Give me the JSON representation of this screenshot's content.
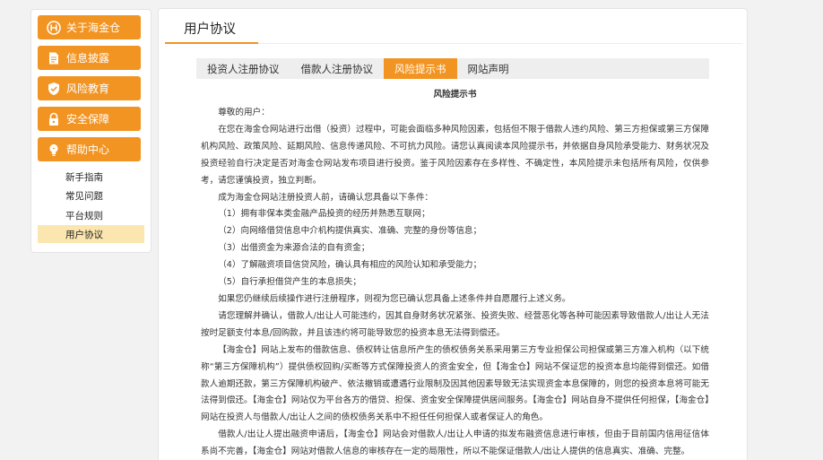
{
  "sidebar": {
    "menu": [
      {
        "label": "关于海金仓",
        "icon": "h-logo-icon"
      },
      {
        "label": "信息披露",
        "icon": "document-icon"
      },
      {
        "label": "风险教育",
        "icon": "shield-icon"
      },
      {
        "label": "安全保障",
        "icon": "lock-icon"
      },
      {
        "label": "帮助中心",
        "icon": "lightbulb-icon"
      }
    ],
    "help_items": [
      "新手指南",
      "常见问题",
      "平台规则",
      "用户协议"
    ],
    "active_item": "用户协议"
  },
  "main": {
    "title": "用户协议",
    "tabs": [
      "投资人注册协议",
      "借款人注册协议",
      "风险提示书",
      "网站声明"
    ],
    "active_tab": "风险提示书"
  },
  "document": {
    "title": "风险提示书",
    "greeting": "尊敬的用户：",
    "paragraphs": [
      "在您在海金仓网站进行出借（投资）过程中，可能会面临多种风险因素，包括但不限于借款人违约风险、第三方担保或第三方保障机构风险、政策风险、延期风险、信息传递风险、不可抗力风险。请您认真阅读本风险提示书，并依据自身风险承受能力、财务状况及投资经验自行决定是否对海金仓网站发布项目进行投资。鉴于风险因素存在多样性、不确定性，本风险提示未包括所有风险，仅供参考，请您谨慎投资，独立判断。",
      "成为海金仓网站注册投资人前，请确认您具备以下条件：",
      "（1）拥有非保本类金融产品投资的经历并熟悉互联网；",
      "（2）向网络借贷信息中介机构提供真实、准确、完整的身份等信息；",
      "（3）出借资金为来源合法的自有资金；",
      "（4）了解融资项目信贷风险，确认具有相应的风险认知和承受能力；",
      "（5）自行承担借贷产生的本息损失；",
      "如果您仍继续后续操作进行注册程序，则视为您已确认您具备上述条件并自愿履行上述义务。",
      "请您理解并确认，借款人/出让人可能违约，因其自身财务状况紧张、投资失败、经营恶化等各种可能因素导致借款人/出让人无法按时足额支付本息/回购款，并且该违约将可能导致您的投资本息无法得到偿还。",
      "【海金仓】网站上发布的借款信息、债权转让信息所产生的债权债务关系采用第三方专业担保公司担保或第三方准入机构（以下统称“第三方保障机构”）提供债权回购/买断等方式保障投资人的资金安全，但【海金仓】网站不保证您的投资本息均能得到偿还。如借款人逾期还款，第三方保障机构破产、依法撤销或遭遇行业限制及因其他因素导致无法实现资金本息保障的，则您的投资本息将可能无法得到偿还。【海金仓】网站仅为平台各方的借贷、担保、资金安全保障提供居间服务。【海金仓】网站自身不提供任何担保，【海金仓】网站在投资人与借款人/出让人之间的债权债务关系中不担任任何担保人或者保证人的角色。",
      "借款人/出让人提出融资申请后，【海金仓】网站会对借款人/出让人申请的拟发布融资信息进行审核，但由于目前国内信用征信体系尚不完善，【海金仓】网站对借款人信息的审核存在一定的局限性，所以不能保证借款人/出让人提供的信息真实、准确、完整。"
    ]
  },
  "colors": {
    "accent": "#f29422",
    "active_item_bg": "#fae6ae",
    "tab_bar_bg": "#eeeeee",
    "page_bg": "#f2f2f2"
  }
}
